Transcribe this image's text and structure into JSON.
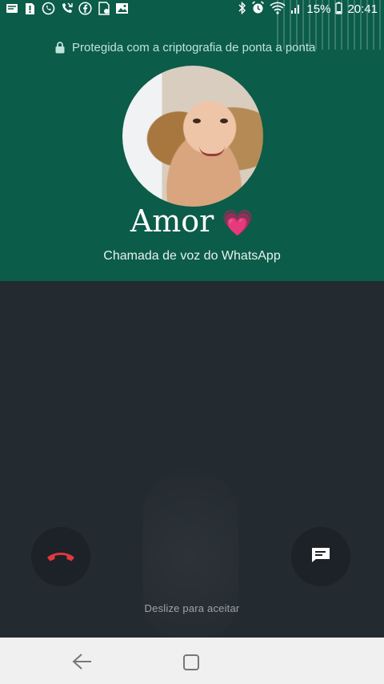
{
  "status_bar": {
    "left_icons": [
      "messaging-icon",
      "sim-alert-icon",
      "whatsapp-icon",
      "missed-call-icon",
      "facebook-icon",
      "download-icon",
      "gallery-icon"
    ],
    "right_icons": [
      "bluetooth-icon",
      "alarm-icon",
      "wifi-icon",
      "signal-icon"
    ],
    "battery": "15%",
    "time": "20:41"
  },
  "encryption_notice": "Protegida com a criptografia de ponta a ponta",
  "caller": {
    "name": "Amor",
    "emoji": "💗"
  },
  "call_type": "Chamada de voz do WhatsApp",
  "actions": {
    "decline_icon": "phone-hangup-icon",
    "message_icon": "message-icon",
    "slide_hint": "Deslize para aceitar"
  },
  "colors": {
    "header_green": "#0b5c49",
    "background": "#232a30",
    "decline_red": "#e0383e"
  },
  "nav": {
    "back_icon": "back-arrow-icon",
    "home_icon": "home-square-icon"
  }
}
